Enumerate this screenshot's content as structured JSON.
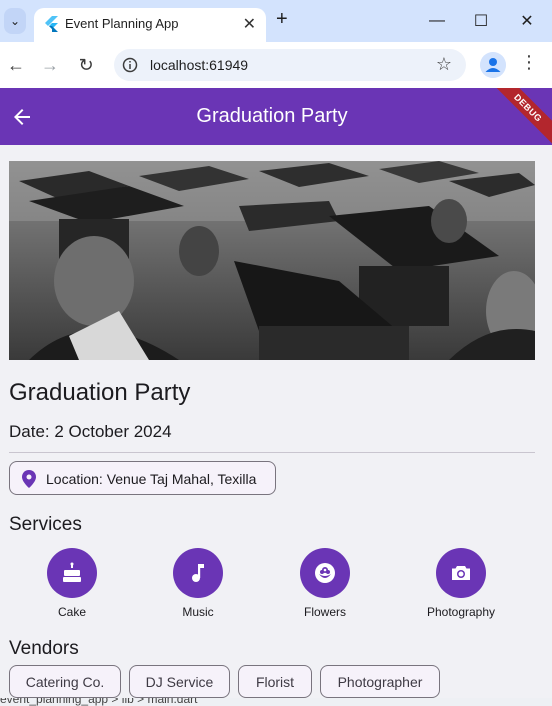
{
  "browser": {
    "tab_title": "Event Planning App",
    "url": "localhost:61949"
  },
  "appbar": {
    "title": "Graduation Party",
    "debug_banner": "DEBUG"
  },
  "event": {
    "title": "Graduation Party",
    "date": "Date: 2 October 2024",
    "location": "Location: Venue Taj Mahal, Texilla",
    "image_desc": "graduates-in-caps"
  },
  "services": {
    "heading": "Services",
    "items": [
      {
        "label": "Cake",
        "icon": "cake-icon"
      },
      {
        "label": "Music",
        "icon": "music-note-icon"
      },
      {
        "label": "Flowers",
        "icon": "flower-icon"
      },
      {
        "label": "Photography",
        "icon": "camera-icon"
      }
    ]
  },
  "vendors": {
    "heading": "Vendors",
    "items": [
      "Catering Co.",
      "DJ Service",
      "Florist",
      "Photographer"
    ]
  },
  "taskbar": {
    "text": "event_planning_app > lib > main.dart"
  },
  "colors": {
    "primary": "#6a35b5",
    "surface": "#f1f1f5",
    "chip_border": "#79747e",
    "debug": "#b3262d"
  }
}
